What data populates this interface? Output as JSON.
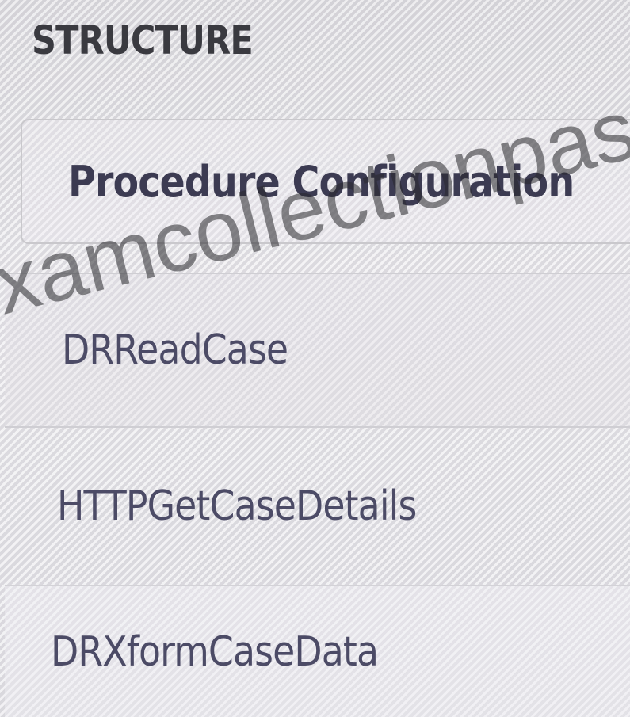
{
  "panel": {
    "title": "STRUCTURE"
  },
  "structure_items": [
    {
      "label": "Procedure Configuration",
      "kind": "header"
    },
    {
      "label": "DRReadCase"
    },
    {
      "label": "HTTPGetCaseDetails"
    },
    {
      "label": "DRXformCaseData"
    }
  ],
  "watermark": {
    "text": "xamcollectionpass.c"
  },
  "colors": {
    "title_text": "#3a3a40",
    "item_text": "#4c4b66",
    "background": "#e9e8ec"
  }
}
